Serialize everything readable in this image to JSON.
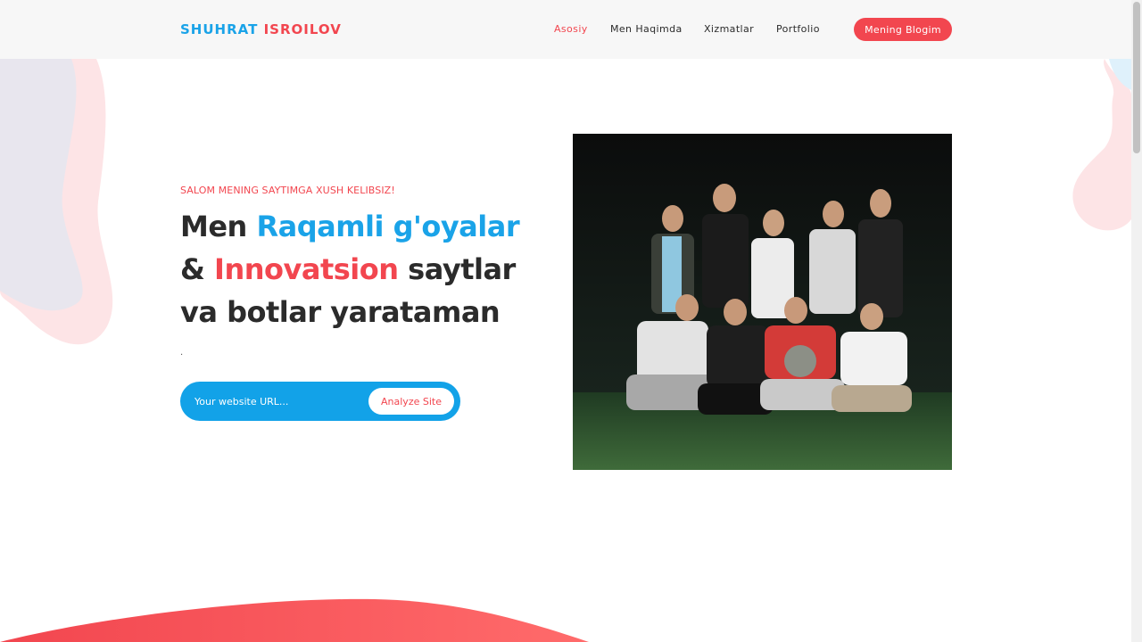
{
  "header": {
    "logo_first": "SHUHRAT",
    "logo_last": "ISROILOV",
    "nav": [
      {
        "label": "Asosiy",
        "active": true
      },
      {
        "label": "Men Haqimda",
        "active": false
      },
      {
        "label": "Xizmatlar",
        "active": false
      },
      {
        "label": "Portfolio",
        "active": false
      }
    ],
    "blog_button": "Mening Blogim"
  },
  "hero": {
    "eyebrow": "SALOM MENING SAYTIMGA XUSH KELIBSIZ!",
    "headline": {
      "part1": "Men ",
      "highlight1": "Raqamli g'oyalar",
      "part2": "& ",
      "highlight2": "Innovatsion",
      "part3": " saytlar",
      "part4": "va botlar yarataman"
    },
    "dot": ".",
    "search": {
      "placeholder": "Your website URL...",
      "button": "Analyze Site"
    }
  },
  "colors": {
    "brand_blue": "#1aa3e8",
    "brand_red": "#f2464f"
  },
  "icons": {
    "photo": "group-photo"
  }
}
